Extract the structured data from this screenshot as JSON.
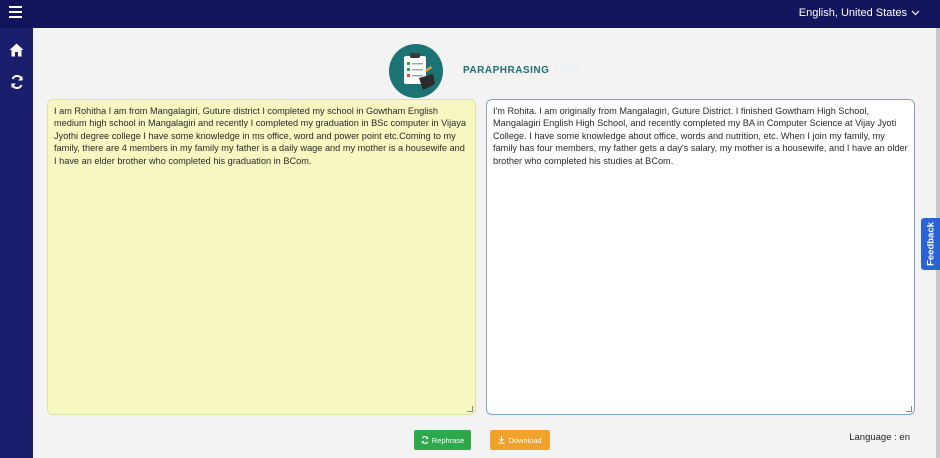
{
  "topbar": {
    "language_selector": "English, United States"
  },
  "header": {
    "title_main": "PARAPHRASING",
    "title_secondary": "TOOL"
  },
  "input_panel": {
    "text": "I am Rohitha I am from Mangalagiri, Guture district I completed my school in Gowtham English medium high school in Mangalagiri and recently I completed my graduation in BSc computer in Vijaya Jyothi degree college I have some knowledge in ms office, word and power point etc.Coming to my family, there are 4 members in my family my father is a daily wage and my mother is a housewife and I have an elder brother who completed his graduation in BCom."
  },
  "output_panel": {
    "text": "I'm Rohita. I am originally from Mangalagiri, Guture District. I finished Gowtham High School, Mangalagiri English High School, and recently completed my BA in Computer Science at Vijay Jyoti College. I have some knowledge about office, words and nutrition, etc. When I join my family, my family has four members, my father gets a day's salary, my mother is a housewife, and I have an older brother who completed his studies at BCom."
  },
  "actions": {
    "rephrase_label": "Rephrase",
    "download_label": "Download"
  },
  "footer": {
    "language_label": "Language : en"
  },
  "feedback": {
    "label": "Feedback"
  },
  "colors": {
    "topbar": "#12155c",
    "sidebar": "#1a1d6b",
    "input_bg": "#f7f7c2",
    "rephrase": "#2ea84a",
    "download": "#f0a22a",
    "feedback": "#2a63d6"
  },
  "icons": {
    "menu": "hamburger-icon",
    "home": "home-icon",
    "refresh": "refresh-icon",
    "chevron": "chevron-down-icon",
    "download": "download-icon"
  }
}
